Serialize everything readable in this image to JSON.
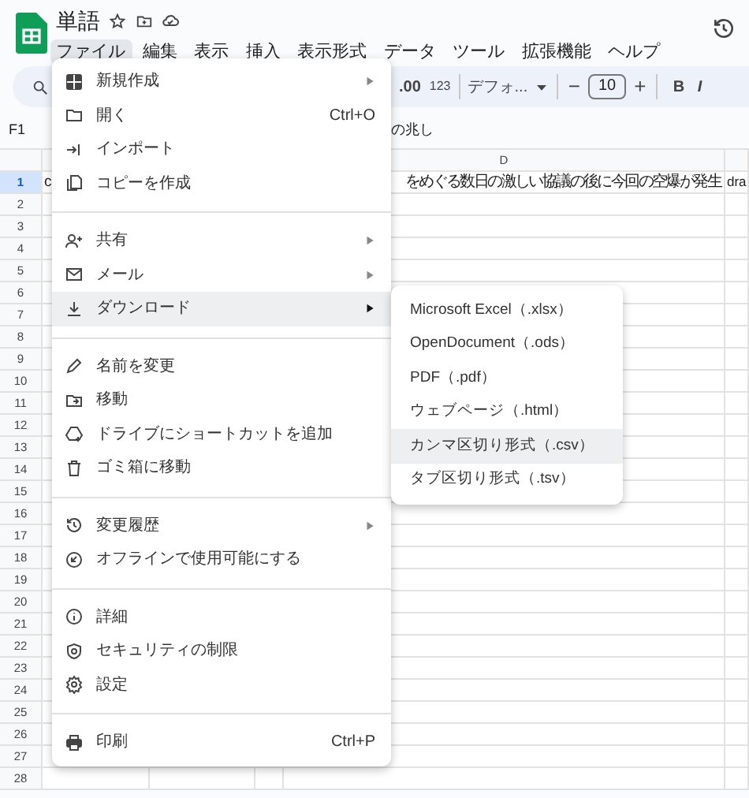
{
  "app": {
    "title": "単語"
  },
  "menubar": [
    {
      "label": "ファイル",
      "selected": true
    },
    {
      "label": "編集",
      "selected": false
    },
    {
      "label": "表示",
      "selected": false
    },
    {
      "label": "挿入",
      "selected": false
    },
    {
      "label": "表示形式",
      "selected": false
    },
    {
      "label": "データ",
      "selected": false
    },
    {
      "label": "ツール",
      "selected": false
    },
    {
      "label": "拡張機能",
      "selected": false
    },
    {
      "label": "ヘルプ",
      "selected": false
    }
  ],
  "toolbar": {
    "decimal": ".00",
    "number_format": "123",
    "font": "デフォ...",
    "minus": "−",
    "font_size": "10",
    "plus": "+",
    "bold": "B",
    "italic": "I"
  },
  "formula_bar": {
    "cell_ref": "F1",
    "content": "の兆し"
  },
  "sheet": {
    "column_d": "D",
    "rows": [
      {
        "number": "1",
        "selected": true,
        "cell_a": "c",
        "cell_d": "をめぐる数日の激しい協議の後に今回の空爆が発生",
        "cell_e": "dra"
      },
      {
        "number": "2",
        "selected": false
      },
      {
        "number": "3",
        "selected": false
      },
      {
        "number": "4",
        "selected": false
      },
      {
        "number": "5",
        "selected": false
      },
      {
        "number": "6",
        "selected": false
      },
      {
        "number": "7",
        "selected": false
      },
      {
        "number": "8",
        "selected": false
      },
      {
        "number": "9",
        "selected": false
      },
      {
        "number": "10",
        "selected": false
      },
      {
        "number": "11",
        "selected": false
      },
      {
        "number": "12",
        "selected": false
      },
      {
        "number": "13",
        "selected": false
      },
      {
        "number": "14",
        "selected": false
      },
      {
        "number": "15",
        "selected": false
      },
      {
        "number": "16",
        "selected": false
      },
      {
        "number": "17",
        "selected": false
      },
      {
        "number": "18",
        "selected": false
      },
      {
        "number": "19",
        "selected": false
      },
      {
        "number": "20",
        "selected": false
      },
      {
        "number": "21",
        "selected": false
      },
      {
        "number": "22",
        "selected": false
      },
      {
        "number": "23",
        "selected": false
      },
      {
        "number": "24",
        "selected": false
      },
      {
        "number": "25",
        "selected": false
      },
      {
        "number": "26",
        "selected": false
      },
      {
        "number": "27",
        "selected": false
      },
      {
        "number": "28",
        "selected": false
      }
    ]
  },
  "file_menu": [
    [
      {
        "label": "新規作成",
        "submenu": true,
        "selected": false
      },
      {
        "label": "開く",
        "shortcut": "Ctrl+O",
        "selected": false
      },
      {
        "label": "インポート",
        "selected": false
      },
      {
        "label": "コピーを作成",
        "selected": false
      }
    ],
    [
      {
        "label": "共有",
        "submenu": true,
        "selected": false
      },
      {
        "label": "メール",
        "submenu": true,
        "selected": false
      },
      {
        "label": "ダウンロード",
        "submenu": true,
        "selected": true
      }
    ],
    [
      {
        "label": "名前を変更",
        "selected": false
      },
      {
        "label": "移動",
        "selected": false
      },
      {
        "label": "ドライブにショートカットを追加",
        "selected": false
      },
      {
        "label": "ゴミ箱に移動",
        "selected": false
      }
    ],
    [
      {
        "label": "変更履歴",
        "submenu": true,
        "selected": false
      },
      {
        "label": "オフラインで使用可能にする",
        "selected": false
      }
    ],
    [
      {
        "label": "詳細",
        "selected": false
      },
      {
        "label": "セキュリティの制限",
        "selected": false
      },
      {
        "label": "設定",
        "selected": false
      }
    ],
    [
      {
        "label": "印刷",
        "shortcut": "Ctrl+P",
        "selected": false
      }
    ]
  ],
  "download_menu": [
    {
      "label": "Microsoft Excel（.xlsx）",
      "selected": false
    },
    {
      "label": "OpenDocument（.ods）",
      "selected": false
    },
    {
      "label": "PDF（.pdf）",
      "selected": false
    },
    {
      "label": "ウェブページ（.html）",
      "selected": false
    },
    {
      "label": "カンマ区切り形式（.csv）",
      "selected": true
    },
    {
      "label": "タブ区切り形式（.tsv）",
      "selected": false
    }
  ]
}
